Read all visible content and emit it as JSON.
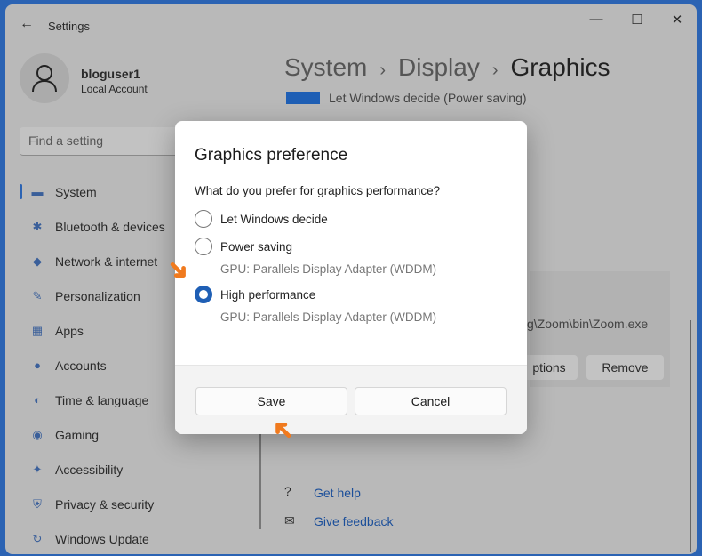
{
  "window": {
    "title": "Settings",
    "back": "←",
    "minimize": "—",
    "maximize": "☐",
    "close": "✕"
  },
  "user": {
    "name": "bloguser1",
    "type": "Local Account"
  },
  "search": {
    "placeholder": "Find a setting"
  },
  "nav": [
    {
      "label": "System",
      "icon": "▬"
    },
    {
      "label": "Bluetooth & devices",
      "icon": "✱"
    },
    {
      "label": "Network & internet",
      "icon": "◆"
    },
    {
      "label": "Personalization",
      "icon": "✎"
    },
    {
      "label": "Apps",
      "icon": "▦"
    },
    {
      "label": "Accounts",
      "icon": "●"
    },
    {
      "label": "Time & language",
      "icon": "◐"
    },
    {
      "label": "Gaming",
      "icon": "◉"
    },
    {
      "label": "Accessibility",
      "icon": "✦"
    },
    {
      "label": "Privacy & security",
      "icon": "⛨"
    },
    {
      "label": "Windows Update",
      "icon": "↻"
    }
  ],
  "breadcrumb": {
    "a": "System",
    "b": "Display",
    "c": "Graphics",
    "sep": "›"
  },
  "background": {
    "app_pref": "Let Windows decide (Power saving)",
    "app_path": "g\\Zoom\\bin\\Zoom.exe",
    "options": "ptions",
    "remove": "Remove",
    "help": "Get help",
    "feedback": "Give feedback"
  },
  "dialog": {
    "title": "Graphics preference",
    "question": "What do you prefer for graphics performance?",
    "options": [
      {
        "label": "Let Windows decide",
        "selected": false
      },
      {
        "label": "Power saving",
        "sub": "GPU: Parallels Display Adapter (WDDM)",
        "selected": false
      },
      {
        "label": "High performance",
        "sub": "GPU: Parallels Display Adapter (WDDM)",
        "selected": true
      }
    ],
    "save": "Save",
    "cancel": "Cancel"
  },
  "colors": {
    "accent": "#1f5fb5",
    "arrow": "#f07a1e"
  }
}
